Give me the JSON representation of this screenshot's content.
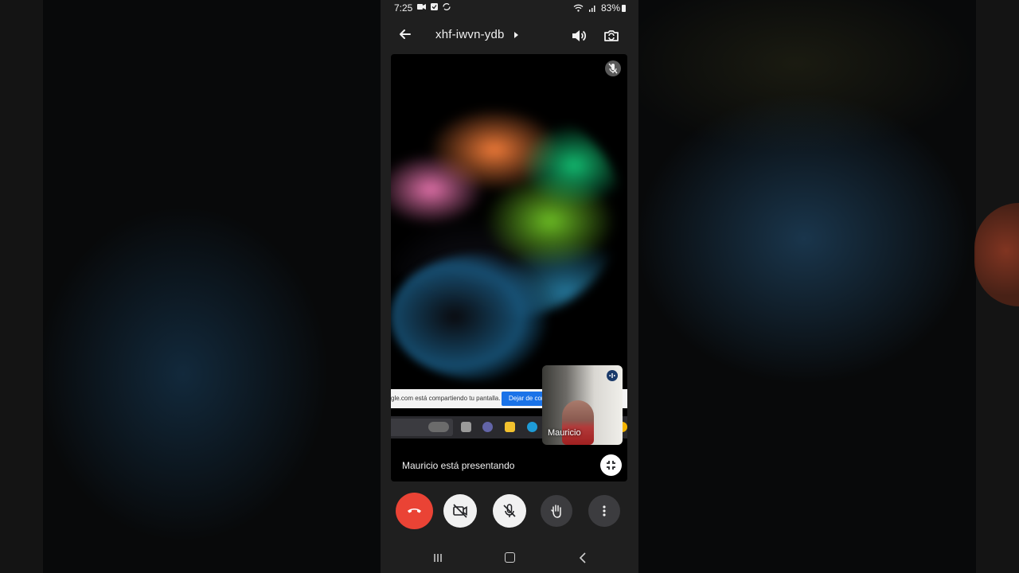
{
  "status_bar": {
    "time": "7:25",
    "battery": "83%"
  },
  "app_bar": {
    "meeting_code": "xhf-iwvn-ydb"
  },
  "stage": {
    "share_bar_message": "gle.com está compartiendo tu pantalla.",
    "share_bar_button": "Dejar de compartir",
    "self_view_name": "Mauricio",
    "presenting_text": "Mauricio está presentando"
  },
  "controls": {
    "end_call_color": "#ea4335",
    "items": [
      "end-call",
      "camera-off",
      "mic-off",
      "raise-hand",
      "more-options"
    ]
  },
  "colors": {
    "phone_background": "#1f1f1f",
    "stage_background": "#000000",
    "accent_blue": "#1a73e8"
  }
}
